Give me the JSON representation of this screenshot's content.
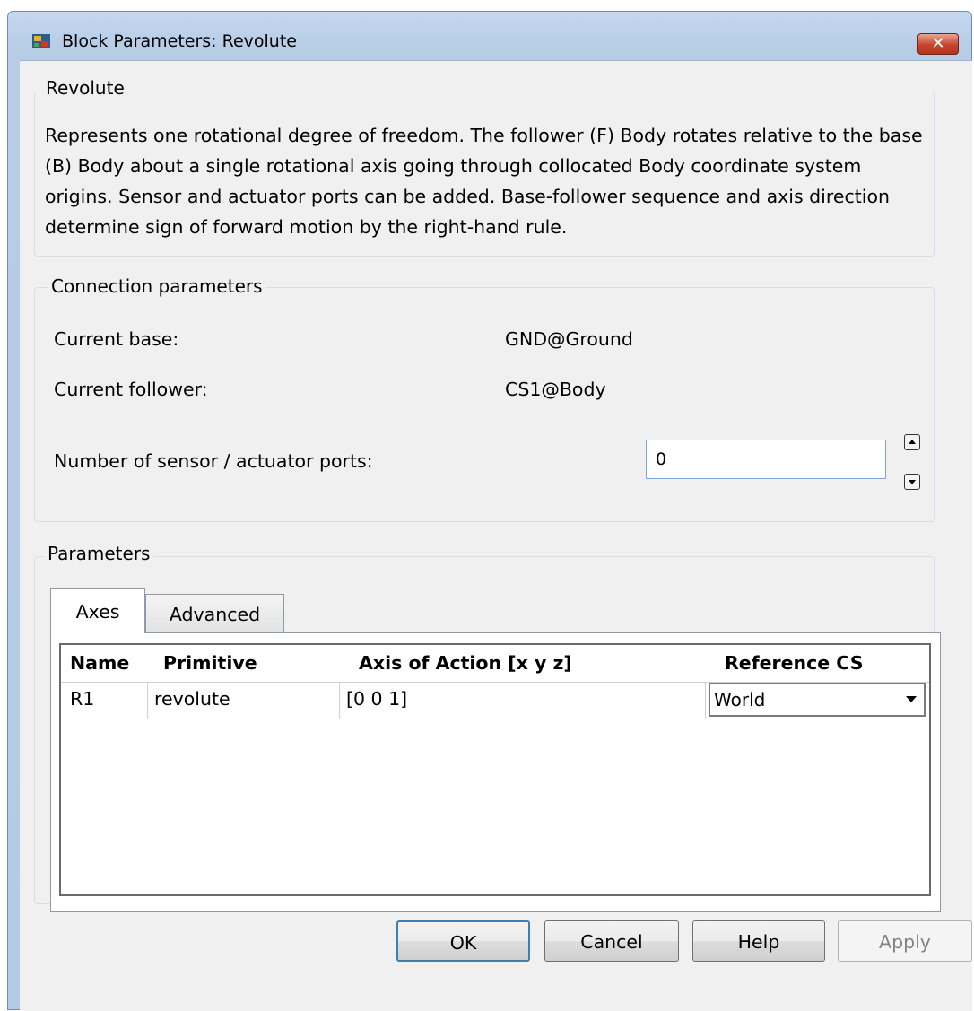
{
  "window": {
    "title": "Block Parameters: Revolute",
    "close_symbol": "✕"
  },
  "revolute_group": {
    "legend": "Revolute",
    "description": "Represents one rotational degree of freedom. The follower (F) Body rotates relative to the base (B) Body about a single rotational axis going through collocated Body coordinate system origins. Sensor and actuator ports can be added. Base-follower sequence and axis direction determine sign of forward motion by the right-hand rule."
  },
  "connection": {
    "legend": "Connection parameters",
    "current_base_label": "Current base:",
    "current_base_value": "GND@Ground",
    "current_follower_label": "Current follower:",
    "current_follower_value": "CS1@Body",
    "ports_label": "Number of sensor / actuator ports:",
    "ports_value": "0"
  },
  "parameters": {
    "legend": "Parameters",
    "tabs": [
      {
        "label": "Axes",
        "active": true
      },
      {
        "label": "Advanced",
        "active": false
      }
    ],
    "table": {
      "columns": [
        "Name",
        "Primitive",
        "Axis of Action [x y z]",
        "Reference CS"
      ],
      "rows": [
        {
          "name": "R1",
          "primitive": "revolute",
          "axis": "[0 0 1]",
          "reference_cs": "World"
        }
      ]
    }
  },
  "buttons": {
    "ok": "OK",
    "cancel": "Cancel",
    "help": "Help",
    "apply": "Apply"
  },
  "icons": [
    "app-icon",
    "close-icon",
    "spin-up-icon",
    "spin-down-icon",
    "dropdown-arrow-icon"
  ]
}
